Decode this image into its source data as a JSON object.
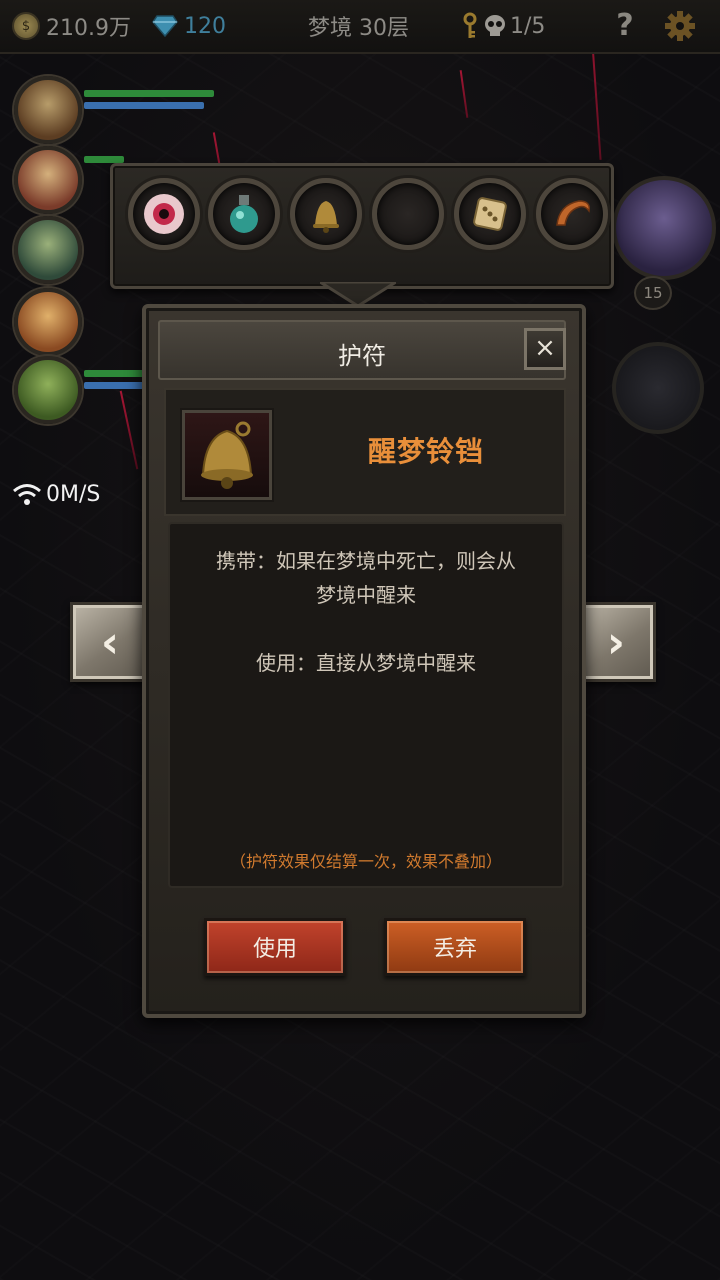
{
  "topbar": {
    "gold": "210.9万",
    "gold_icon": "coin-icon",
    "gems": "120",
    "gem_icon": "diamond-icon",
    "floor": "梦境 30层",
    "dead_count": "1/5",
    "help_label": "?",
    "settings_icon": "gear-icon"
  },
  "amulet_slots": [
    {
      "icon": "eyeball-amulet-icon"
    },
    {
      "icon": "potion-amulet-icon"
    },
    {
      "icon": "bell-amulet-icon"
    },
    {
      "icon": "empty-slot"
    },
    {
      "icon": "dice-amulet-icon"
    },
    {
      "icon": "horn-amulet-icon"
    }
  ],
  "side_hero": {
    "level": "15"
  },
  "network": {
    "speed": "0M/S"
  },
  "dialog": {
    "title": "护符",
    "close_label": "×",
    "item_name": "醒梦铃铛",
    "item_icon": "bell-icon",
    "desc_carry_line1": "携带：如果在梦境中死亡，则会从",
    "desc_carry_line2": "梦境中醒来",
    "desc_use": "使用：直接从梦境中醒来",
    "note": "（护符效果仅结算一次，效果不叠加）",
    "use_button": "使用",
    "discard_button": "丢弃",
    "prev_label": "‹",
    "next_label": "›"
  },
  "colors": {
    "item_name": "#e98f3a",
    "note": "#d17a2e",
    "use_button": "#b33a26",
    "discard_button": "#c3561f",
    "hp_bar": "#2e8a3a",
    "mp_bar": "#3a6fae"
  }
}
